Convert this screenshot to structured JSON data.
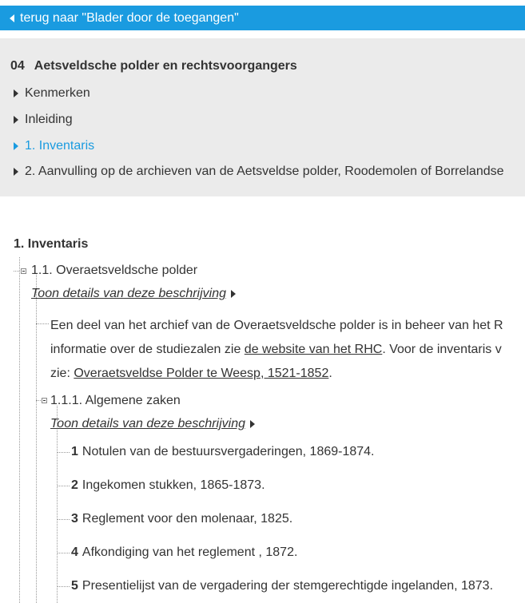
{
  "back_link": "terug naar \"Blader door de toegangen\"",
  "toc": {
    "number": "04",
    "title": "Aetsveldsche polder en rechtsvoorgangers",
    "items": [
      {
        "label": "Kenmerken"
      },
      {
        "label": "Inleiding"
      },
      {
        "label": "1. Inventaris"
      },
      {
        "label": "2. Aanvulling op de archieven van de Aetsveldse polder, Roodemolen of Borrelandse"
      }
    ]
  },
  "section": {
    "title": "1. Inventaris",
    "node1": {
      "label": "1.1. Overaetsveldsche polder",
      "details_link": "Toon details van deze beschrijving",
      "desc_line1": "Een deel van het archief van de Overaetsveldsche polder is in beheer van het R",
      "desc_line2_pre": "informatie over de studiezalen zie ",
      "desc_line2_link": "de website van het RHC",
      "desc_line2_post": ". Voor de inventaris v",
      "desc_line3_pre": "zie: ",
      "desc_line3_link": "Overaetsveldse Polder te Weesp, 1521-1852",
      "desc_line3_post": "."
    },
    "node2": {
      "label": "1.1.1. Algemene zaken",
      "details_link": "Toon details van deze beschrijving",
      "items": [
        {
          "num": "1",
          "text": "Notulen van de bestuursvergaderingen, 1869-1874."
        },
        {
          "num": "2",
          "text": "Ingekomen stukken, 1865-1873."
        },
        {
          "num": "3",
          "text": "Reglement voor den molenaar, 1825."
        },
        {
          "num": "4",
          "text": "Afkondiging van het reglement , 1872."
        },
        {
          "num": "5",
          "text": "Presentielijst van de vergadering der stemgerechtigde ingelanden, 1873."
        }
      ]
    }
  }
}
